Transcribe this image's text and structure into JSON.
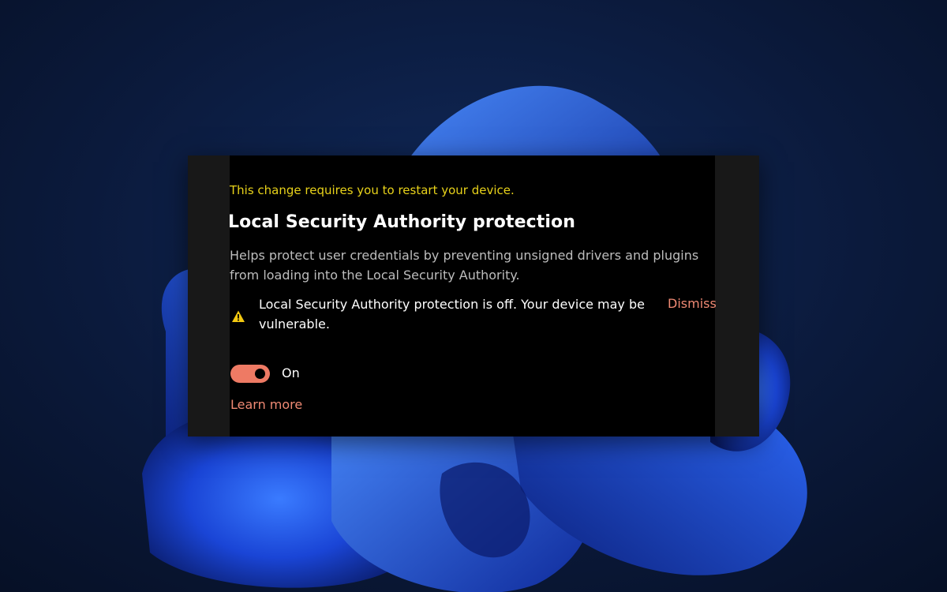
{
  "colors": {
    "panel_background": "#000000",
    "restart_note": "#e8d21a",
    "accent": "#ee7a64",
    "link": "#f08a74",
    "warning_icon": "#f2c811",
    "wallpaper_bloom": "#1f4fe0"
  },
  "setting": {
    "restart_note": "This change requires you to restart your device.",
    "title": "Local Security Authority protection",
    "description": "Helps protect user credentials by preventing unsigned drivers and plugins from loading into the Local Security Authority.",
    "warning": {
      "icon": "warning-icon",
      "text": "Local Security Authority protection is off. Your device may be vulnerable.",
      "dismiss_label": "Dismiss"
    },
    "toggle": {
      "state": "on",
      "label": "On"
    },
    "learn_more_label": "Learn more"
  }
}
